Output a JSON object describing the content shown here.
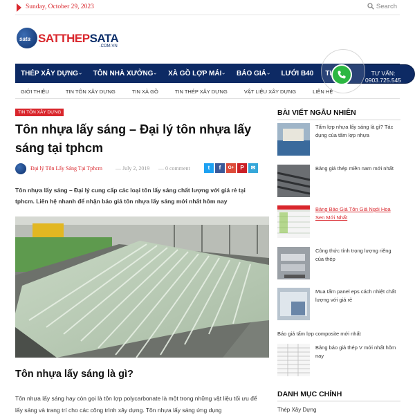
{
  "topbar": {
    "date": "Sunday, October 29, 2023",
    "search_label": "Search"
  },
  "logo": {
    "mark": "sata",
    "brand_a": "SATTHEP",
    "brand_b": "SATA",
    "sub": ".COM.VN"
  },
  "main_nav": [
    {
      "label": "THÉP XÂY DỰNG",
      "has_dropdown": true
    },
    {
      "label": "TÔN NHÀ XƯỞNG",
      "has_dropdown": true
    },
    {
      "label": "XÀ GỒ LỢP MÁI",
      "has_dropdown": true
    },
    {
      "label": "BÁO GIÁ",
      "has_dropdown": true
    },
    {
      "label": "LƯỚI B40",
      "has_dropdown": false
    },
    {
      "label": "TIN TỨC",
      "has_dropdown": true
    }
  ],
  "phone": {
    "label": "TƯ VẤN:",
    "number": "0903.725.545"
  },
  "sub_nav": [
    "GIỚI THIỆU",
    "TIN TÔN XÂY DỰNG",
    "TIN XÀ GỒ",
    "TIN THÉP XÂY DỰNG",
    "VẬT LIỆU XÂY DỰNG",
    "LIÊN HỆ"
  ],
  "article": {
    "category": "TIN TÔN XÂY DỰNG",
    "title": "Tôn nhựa lấy sáng – Đại lý tôn nhựa lấy sáng tại tphcm",
    "author": "Đại lý Tôn Lấy Sáng Tại Tphcm",
    "date_sep": "— July 2, 2019",
    "comments_sep": "— 0 comment",
    "share": [
      "t",
      "f",
      "G+",
      "P",
      "✉"
    ],
    "intro": "Tôn nhựa lấy sáng – Đại lý cung cấp các loại tôn lấy sáng chất lượng với giá rẻ tại tphcm. Liên hệ nhanh để nhận báo giá tôn nhựa lấy sáng mới nhất hôm nay",
    "section_heading": "Tôn nhựa lấy sáng là gì?",
    "body": "Tôn nhựa lấy sáng hay còn gọi là tôn lợp polycarbonate là một trong những vật liệu tối ưu để lấy sáng và trang trí cho các công trình xây dựng. Tôn nhựa lấy sáng ứng dụng"
  },
  "sidebar": {
    "random_heading": "BÀI VIẾT NGẪU NHIÊN",
    "posts": [
      {
        "title": "Tấm lợp nhựa lấy sáng là gì? Tác dụng của tấm lợp nhựa",
        "has_thumb": true,
        "link": false
      },
      {
        "title": "Bảng giá thép miền nam mới nhất",
        "has_thumb": true,
        "link": false
      },
      {
        "title": "Bảng Báo Giá Tôn Giả Ngói Hoa Sen Mới Nhất",
        "has_thumb": true,
        "link": true
      },
      {
        "title": "Công thức tính trọng lượng riêng của thép",
        "has_thumb": true,
        "link": false
      },
      {
        "title": "Mua tấm panel eps cách nhiệt chất lượng với giá rẻ",
        "has_thumb": true,
        "link": false
      },
      {
        "title": "Báo giá tấm lợp composite mới nhất",
        "has_thumb": false,
        "link": false
      },
      {
        "title": "Bảng báo giá thép V mới nhất hôm nay",
        "has_thumb": true,
        "link": false
      }
    ],
    "main_cat_heading": "DANH MỤC CHÍNH",
    "main_cat_first": "Thép Xây Dựng"
  },
  "colors": {
    "accent": "#d9262c",
    "nav_bg": "#0d2a64",
    "phone_green": "#2cb742"
  },
  "icons": {
    "date": "caret-right-icon",
    "search": "search-icon",
    "phone": "phone-icon"
  }
}
